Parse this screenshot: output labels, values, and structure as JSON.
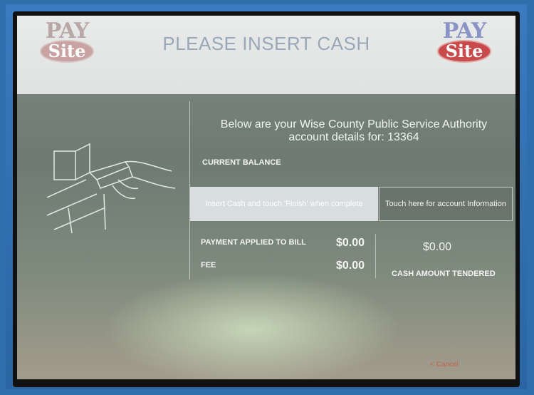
{
  "header": {
    "title": "PLEASE INSERT CASH",
    "logo_left": {
      "pay": "PAY",
      "site": "Site"
    },
    "logo_right": {
      "pay": "PAY",
      "site": "Site"
    }
  },
  "details": {
    "line1": "Below are your Wise County Public Service Authority",
    "line2": "account details for: 13364"
  },
  "balance": {
    "label": "CURRENT BALANCE"
  },
  "actions": {
    "insert_cash_label": "Insert Cash and touch 'Finish' when complete",
    "account_info_label": "Touch here for account Information"
  },
  "amounts": {
    "payment_label": "PAYMENT APPLIED TO BILL",
    "payment_value": "$0.00",
    "fee_label": "FEE",
    "fee_value": "$0.00",
    "tendered_value": "$0.00",
    "tendered_label": "CASH AMOUNT TENDERED"
  },
  "footer": {
    "cancel_label": "< Cancel"
  },
  "colors": {
    "bezel": "#2f6fae",
    "header_bg": "#e9ebea",
    "title": "#9aa7b9",
    "cancel": "#d64b3a"
  },
  "icons": {
    "illustration": "cash-slot-insert-icon"
  }
}
